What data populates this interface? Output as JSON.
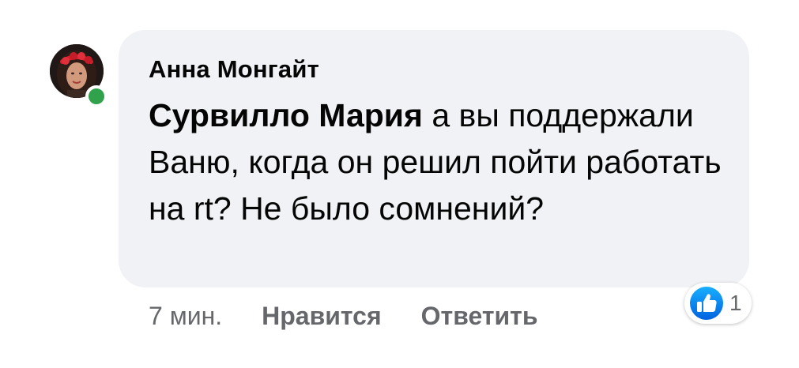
{
  "comment": {
    "author": "Анна Монгайт",
    "mention": "Сурвилло Мария",
    "text": "а вы поддержали Ваню, когда он решил пойти работать на rt? Не было сомнений?",
    "time": "7 мин.",
    "like_label": "Нравится",
    "reply_label": "Ответить",
    "reaction_count": "1"
  },
  "colors": {
    "bubble_background": "#f0f2f5",
    "meta_text": "#65676b",
    "like_blue": "#1877f2",
    "online_green": "#31a24c"
  },
  "icons": {
    "avatar": "user-photo",
    "presence": "online-status-dot",
    "reaction": "thumbs-up-icon"
  }
}
